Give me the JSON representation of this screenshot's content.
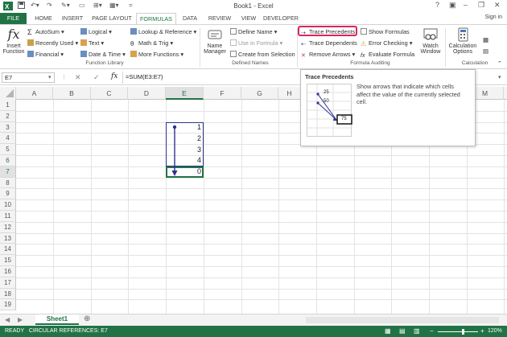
{
  "window": {
    "title": "Book1 - Excel",
    "sign_in": "Sign in",
    "help": "?",
    "minimize": "–",
    "restore": "❐",
    "close": "✕"
  },
  "tabs": [
    "FILE",
    "HOME",
    "INSERT",
    "PAGE LAYOUT",
    "FORMULAS",
    "DATA",
    "REVIEW",
    "VIEW",
    "DEVELOPER"
  ],
  "active_tab": "FORMULAS",
  "ribbon": {
    "insert_function": {
      "line1": "Insert",
      "line2": "Function"
    },
    "autosum": "AutoSum",
    "recently_used": "Recently Used",
    "financial": "Financial",
    "logical": "Logical",
    "text": "Text",
    "date_time": "Date & Time",
    "lookup_reference": "Lookup & Reference",
    "math_trig": "Math & Trig",
    "more_functions": "More Functions",
    "function_library_label": "Function Library",
    "name_manager": {
      "line1": "Name",
      "line2": "Manager"
    },
    "define_name": "Define Name",
    "use_in_formula": "Use in Formula",
    "create_from_selection": "Create from Selection",
    "defined_names_label": "Defined Names",
    "trace_precedents": "Trace Precedents",
    "trace_dependents": "Trace Dependents",
    "remove_arrows": "Remove Arrows",
    "show_formulas": "Show Formulas",
    "error_checking": "Error Checking",
    "evaluate_formula": "Evaluate Formula",
    "watch_window": {
      "line1": "Watch",
      "line2": "Window"
    },
    "formula_auditing_label": "Formula Auditing",
    "calculation_options": {
      "line1": "Calculation",
      "line2": "Options"
    },
    "calculation_label": "Calculation"
  },
  "formula_bar": {
    "name_box": "E7",
    "fx": "fx",
    "formula": "=SUM(E3:E7)"
  },
  "columns": [
    "A",
    "B",
    "C",
    "D",
    "E",
    "F",
    "G",
    "H",
    "M"
  ],
  "rows": [
    "1",
    "2",
    "3",
    "4",
    "5",
    "6",
    "7",
    "8",
    "9",
    "10",
    "11",
    "12",
    "13",
    "14",
    "15",
    "16",
    "17",
    "18",
    "19"
  ],
  "selected_column": "E",
  "selected_row": "7",
  "cells": {
    "E3": "1",
    "E4": "2",
    "E5": "3",
    "E6": "4",
    "E7": "0"
  },
  "tooltip": {
    "title": "Trace Precedents",
    "description": "Show arrows that indicate which cells affect the value of the currently selected cell.",
    "example_values": [
      "25",
      "50",
      "75"
    ]
  },
  "sheets": [
    "Sheet1"
  ],
  "add_sheet": "⊕",
  "status": {
    "text": "READY   CIRCULAR REFERENCES: E7",
    "zoom": "120%",
    "zoom_minus": "−",
    "zoom_plus": "+"
  },
  "colors": {
    "excel_green": "#217346",
    "highlight": "#d9265d",
    "arrow": "#2e3192"
  }
}
